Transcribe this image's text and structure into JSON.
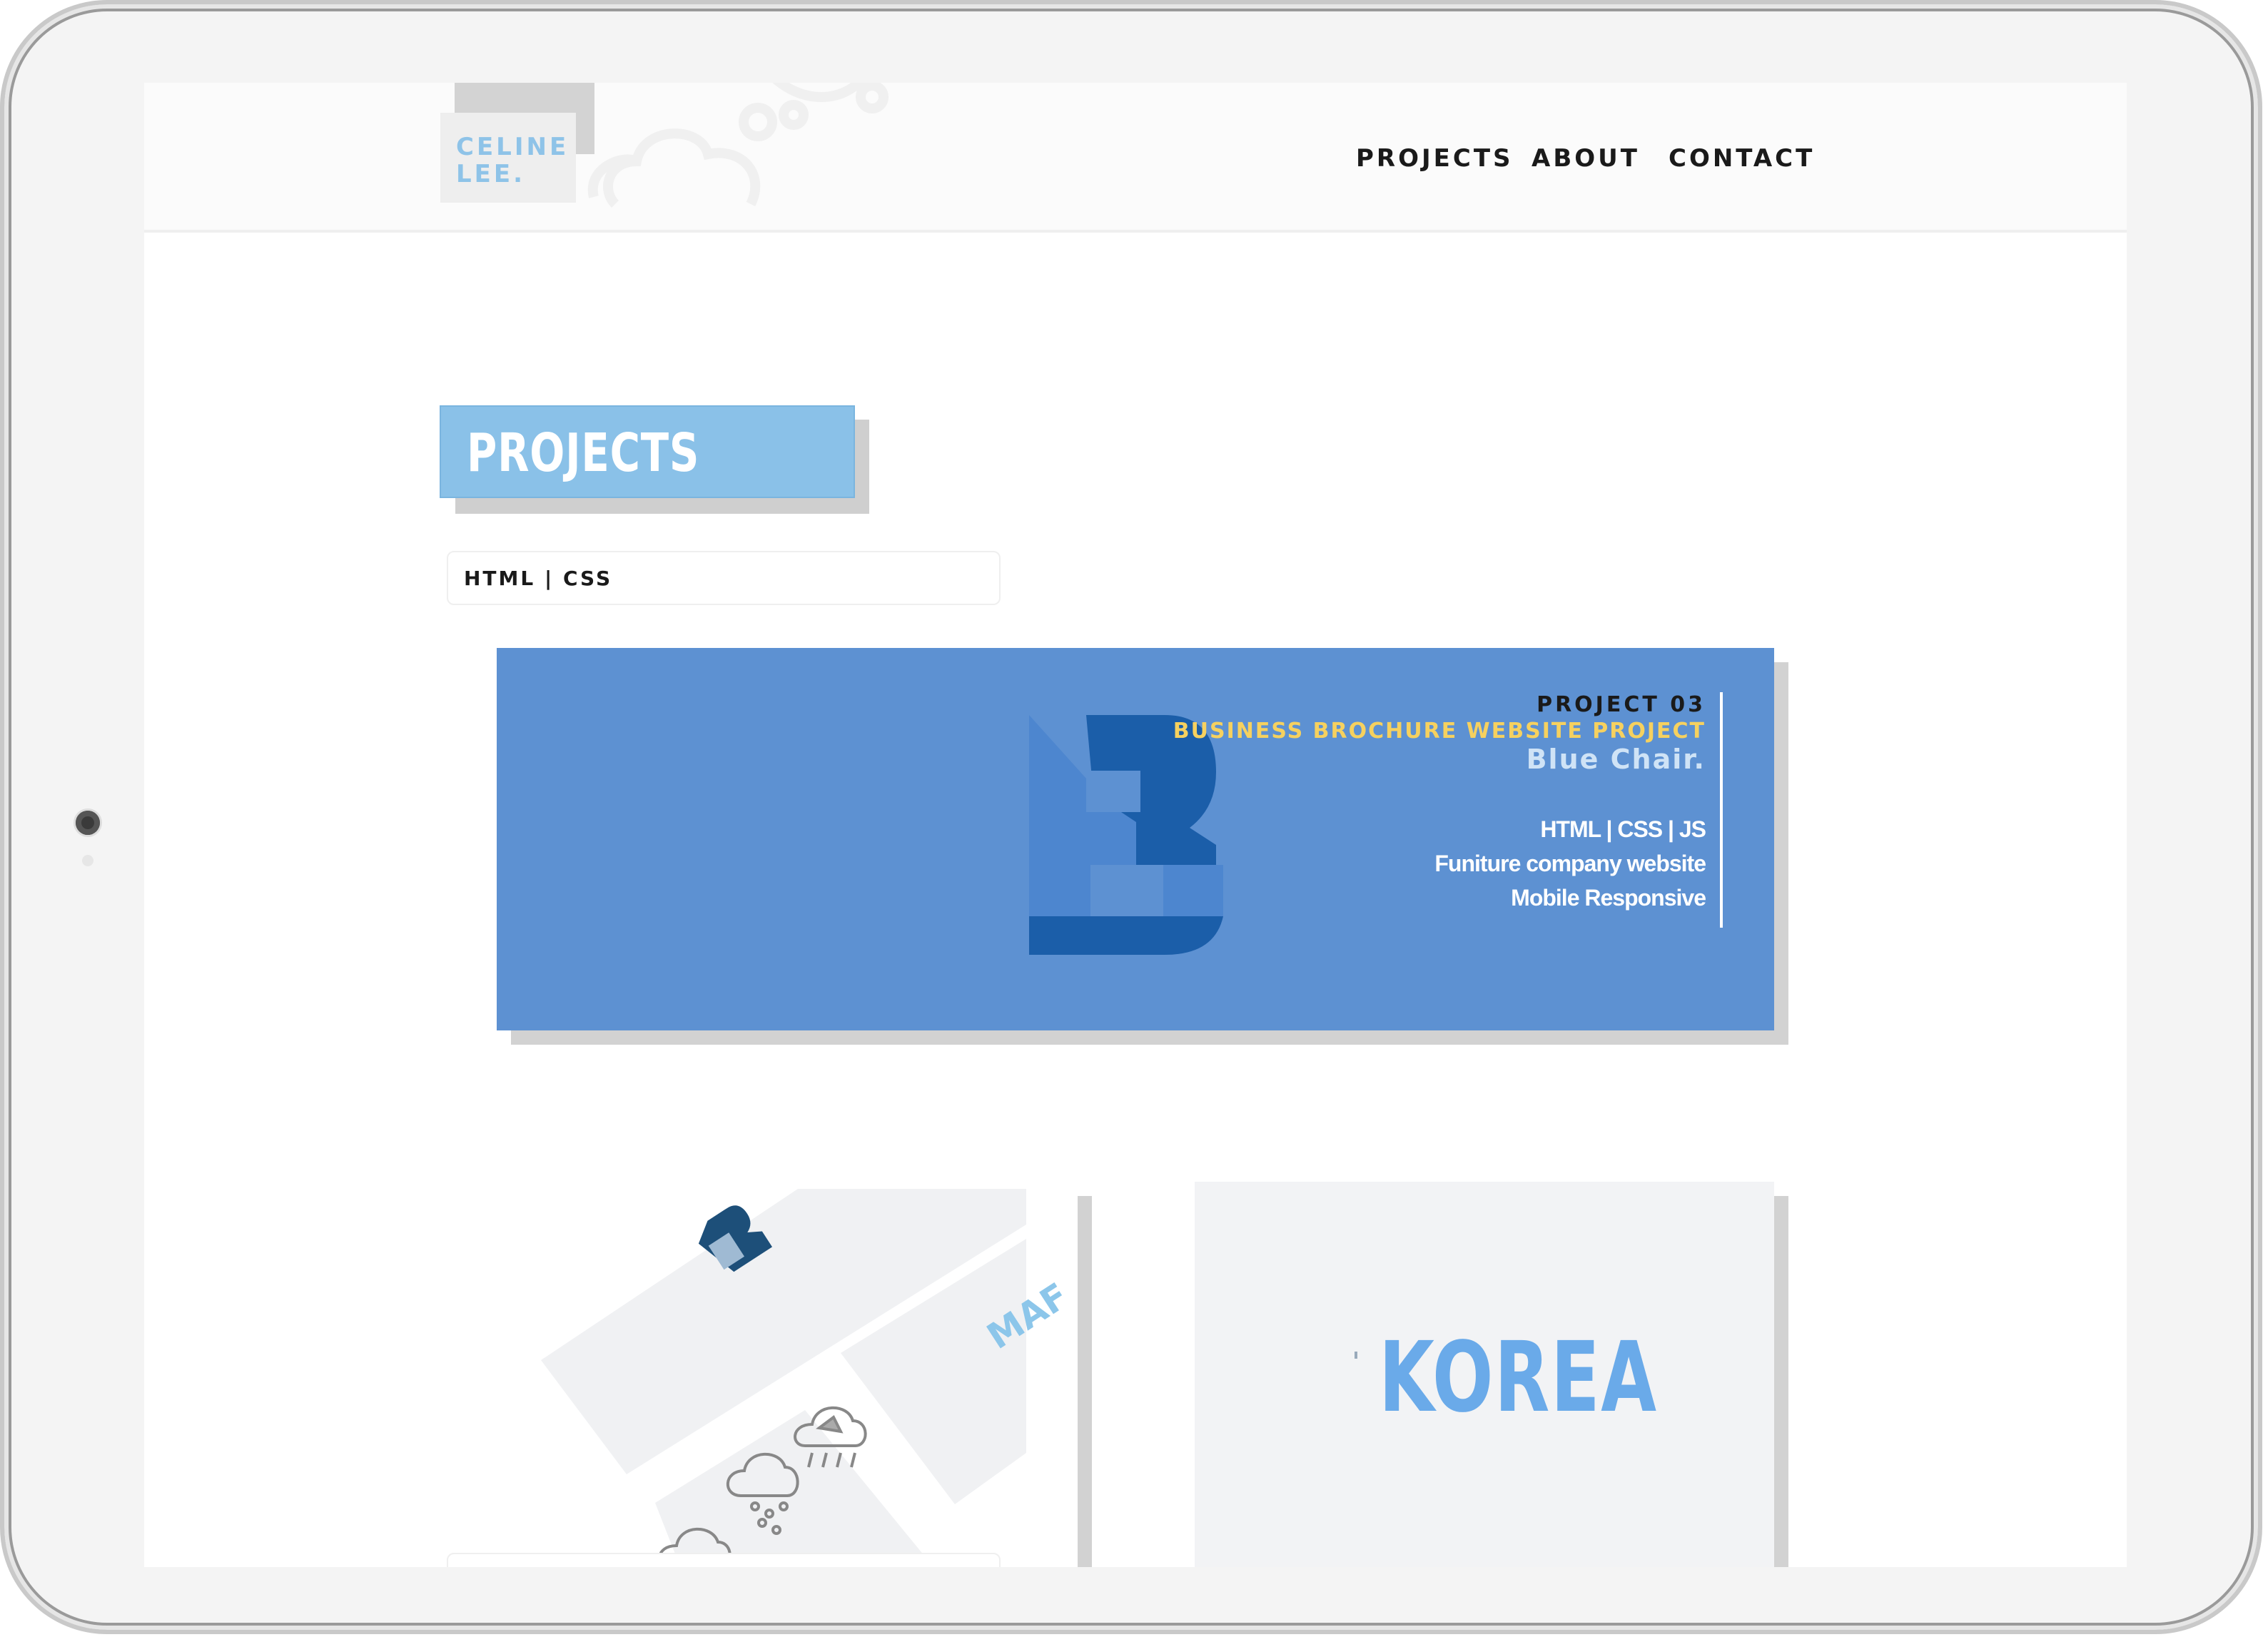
{
  "header": {
    "logo_line1": "CELINE",
    "logo_line2": "LEE.",
    "nav": {
      "projects": "PROJECTS",
      "about": "ABOUT",
      "contact": "CONTACT"
    }
  },
  "main": {
    "section_title": "PROJECTS",
    "filter_label": "HTML | CSS",
    "featured": {
      "number": "PROJECT 03",
      "type": "BUSINESS BROCHURE WEBSITE PROJECT",
      "name": "Blue Chair.",
      "tech": "HTML | CSS | JS",
      "desc": "Funiture company website",
      "feature": "Mobile Responsive"
    },
    "cards": [
      {
        "partial_text": "MAF"
      },
      {
        "title": "KOREA"
      }
    ]
  },
  "colors": {
    "accent_blue": "#8ac1e8",
    "card_blue": "#5d91d2",
    "yellow": "#f6d15f",
    "korea_blue": "#6aaae9"
  }
}
